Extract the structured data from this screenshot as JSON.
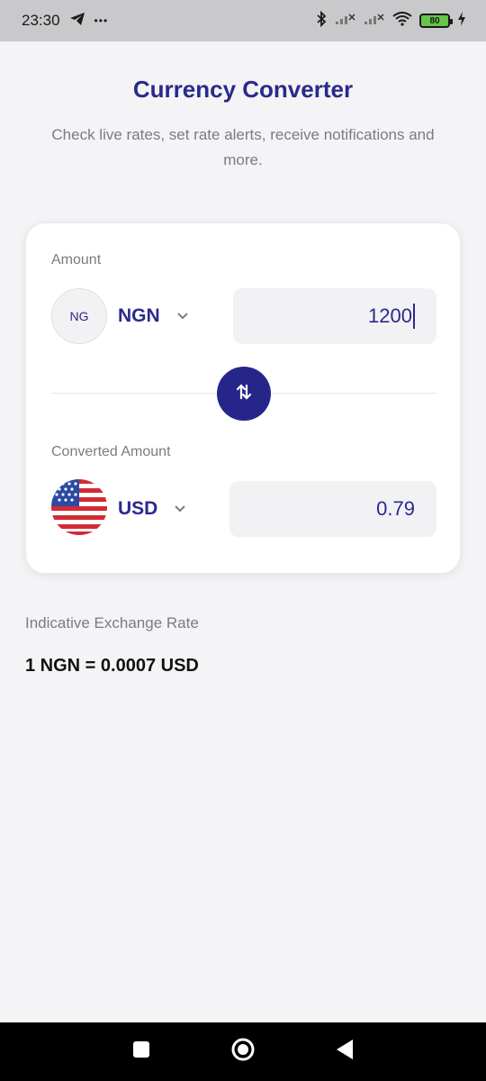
{
  "status_bar": {
    "time": "23:30",
    "dots": "•••",
    "battery": "80",
    "icons": [
      "telegram-icon",
      "bluetooth-icon",
      "signal-icon",
      "wifi-icon",
      "battery-icon",
      "charging-icon"
    ]
  },
  "header": {
    "title": "Currency Converter",
    "subtitle": "Check live rates, set rate alerts, receive notifications and more."
  },
  "converter": {
    "amount_label": "Amount",
    "from": {
      "flag_text": "NG",
      "code": "NGN",
      "value": "1200"
    },
    "converted_label": "Converted Amount",
    "to": {
      "code": "USD",
      "value": "0.79"
    }
  },
  "exchange": {
    "label": "Indicative Exchange Rate",
    "rate": "1 NGN = 0.0007 USD"
  },
  "colors": {
    "accent": "#2a2a8c",
    "swap_button": "#26268a",
    "background": "#f4f4f6"
  }
}
